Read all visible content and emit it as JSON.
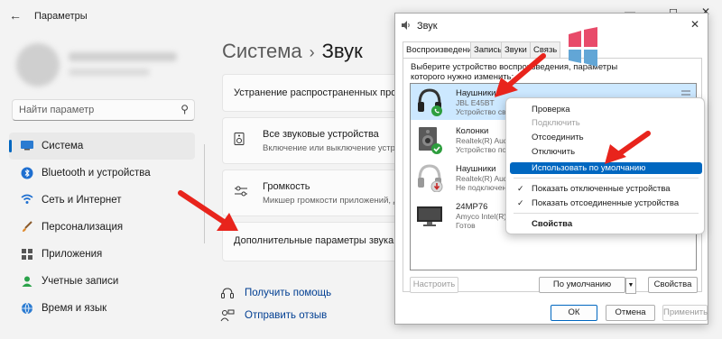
{
  "window": {
    "title": "Параметры",
    "back_icon": "back-arrow-icon",
    "minimize_icon": "minimize-icon",
    "maximize_icon": "maximize-icon",
    "close_icon": "close-icon"
  },
  "search": {
    "placeholder": "Найти параметр",
    "icon": "search-icon"
  },
  "sidebar": {
    "items": [
      {
        "label": "Система",
        "icon": "system-icon",
        "active": true
      },
      {
        "label": "Bluetooth и устройства",
        "icon": "bluetooth-icon"
      },
      {
        "label": "Сеть и Интернет",
        "icon": "wifi-icon"
      },
      {
        "label": "Персонализация",
        "icon": "brush-icon"
      },
      {
        "label": "Приложения",
        "icon": "apps-icon"
      },
      {
        "label": "Учетные записи",
        "icon": "user-icon"
      },
      {
        "label": "Время и язык",
        "icon": "globe-icon"
      }
    ]
  },
  "main": {
    "breadcrumb_parent": "Система",
    "breadcrumb_sep": "›",
    "breadcrumb_current": "Звук",
    "troubleshoot": "Устранение распространенных проб",
    "all_devices_title": "Все звуковые устройства",
    "all_devices_sub": "Включение или выключение устр",
    "volume_title": "Громкость",
    "volume_sub": "Микшер громкости приложений, ди",
    "advanced": "Дополнительные параметры звука",
    "help_link": "Получить помощь",
    "feedback_link": "Отправить отзыв"
  },
  "dialog": {
    "title": "Звук",
    "tabs": [
      "Воспроизведение",
      "Запись",
      "Звуки",
      "Связь"
    ],
    "instruction": "Выберите устройство воспроизведения, параметры которого нужно изменить:",
    "devices": [
      {
        "name": "Наушники",
        "sub1": "JBL E45BT",
        "sub2": "Устройство св",
        "selected": true,
        "status": "phone",
        "icon": "headphones-icon"
      },
      {
        "name": "Колонки",
        "sub1": "Realtek(R) Aud",
        "sub2": "Устройство по",
        "status": "default",
        "icon": "speaker-icon"
      },
      {
        "name": "Наушники",
        "sub1": "Realtek(R) Aud",
        "sub2": "Не подключен",
        "status": "disconnected",
        "icon": "headphones-icon"
      },
      {
        "name": "24MP76",
        "sub1": "Amyco Intel(R)",
        "sub2": "Готов",
        "status": "none",
        "icon": "monitor-icon"
      }
    ],
    "configure_btn": "Настроить",
    "default_btn": "По умолчанию",
    "properties_btn": "Свойства",
    "ok_btn": "ОК",
    "cancel_btn": "Отмена",
    "apply_btn": "Применить"
  },
  "context_menu": {
    "items": [
      {
        "label": "Проверка"
      },
      {
        "label": "Подключить",
        "disabled": true
      },
      {
        "label": "Отсоединить"
      },
      {
        "label": "Отключить"
      },
      {
        "label": "Использовать по умолчанию",
        "highlight": true
      },
      {
        "label": "Показать отключенные устройства",
        "checked": true
      },
      {
        "label": "Показать отсоединенные устройства",
        "checked": true
      },
      {
        "label": "Свойства",
        "bold": true
      }
    ]
  },
  "colors": {
    "accent": "#0067c0",
    "arrow": "#e8241c",
    "selection": "#cce8ff",
    "link": "#003e92"
  }
}
